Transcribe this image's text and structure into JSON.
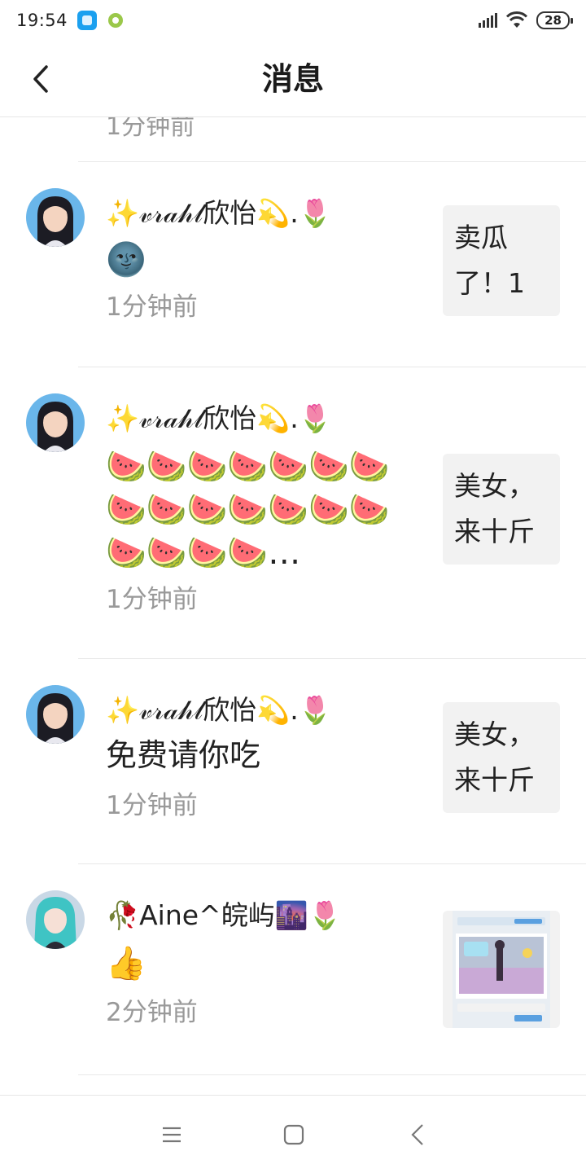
{
  "status_bar": {
    "time": "19:54",
    "battery": "28"
  },
  "header": {
    "title": "消息"
  },
  "partial_top_time": "1分钟前",
  "messages": [
    {
      "name": "✨𝓋𝓇𝒶𝒽𝓁欣怡💫.🌷",
      "message": "🌚",
      "time": "1分钟前",
      "quote": "卖瓜了！1"
    },
    {
      "name": "✨𝓋𝓇𝒶𝒽𝓁欣怡💫.🌷",
      "message": "🍉🍉🍉🍉🍉🍉🍉🍉🍉🍉🍉🍉🍉🍉🍉🍉🍉🍉…",
      "time": "1分钟前",
      "quote": "美女，来十斤"
    },
    {
      "name": "✨𝓋𝓇𝒶𝒽𝓁欣怡💫.🌷",
      "message": "免费请你吃",
      "time": "1分钟前",
      "quote": "美女，来十斤"
    },
    {
      "name": "🥀Aine^皖屿🌆🌷",
      "message": "👍",
      "time": "2分钟前",
      "quote": ""
    }
  ],
  "colors": {
    "text": "#222222",
    "secondary": "#999999",
    "quote_bg": "#f2f2f2",
    "divider": "#e8e8e8"
  }
}
